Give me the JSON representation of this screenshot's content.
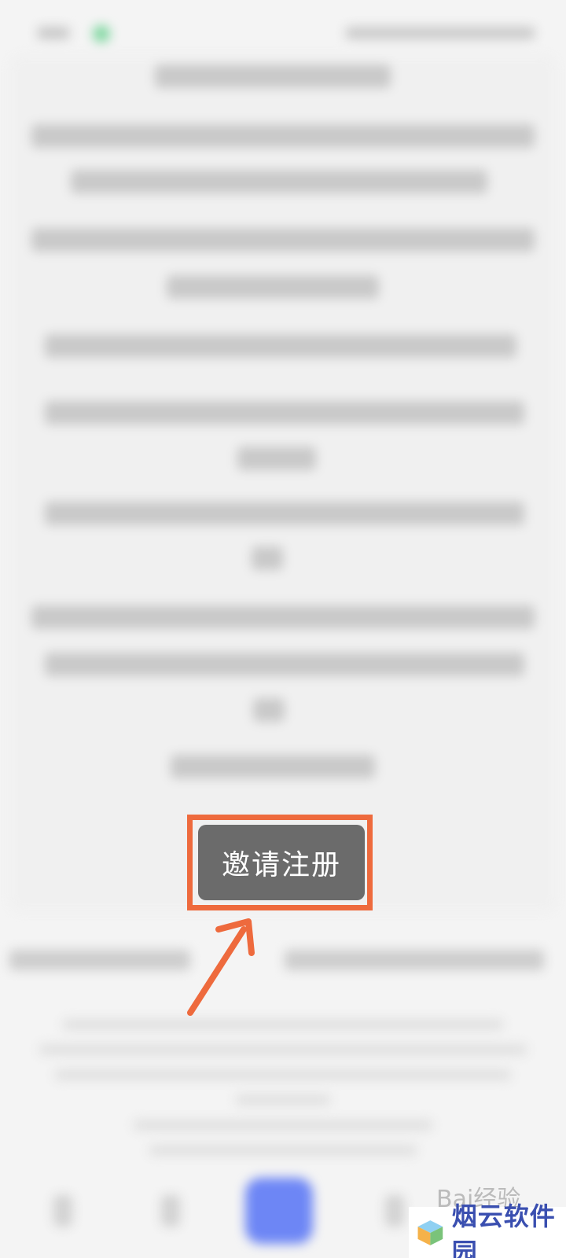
{
  "invite_button": {
    "label": "邀请注册"
  },
  "watermark": {
    "text": "烟云软件园",
    "icon": "cube-logo-icon"
  },
  "baidu_watermark": {
    "text": "Bai经验"
  },
  "colors": {
    "highlight": "#ee6a3d",
    "button_bg": "#6b6b6b",
    "nav_center": "#6d86f5",
    "watermark_text": "#3a4fb0"
  }
}
